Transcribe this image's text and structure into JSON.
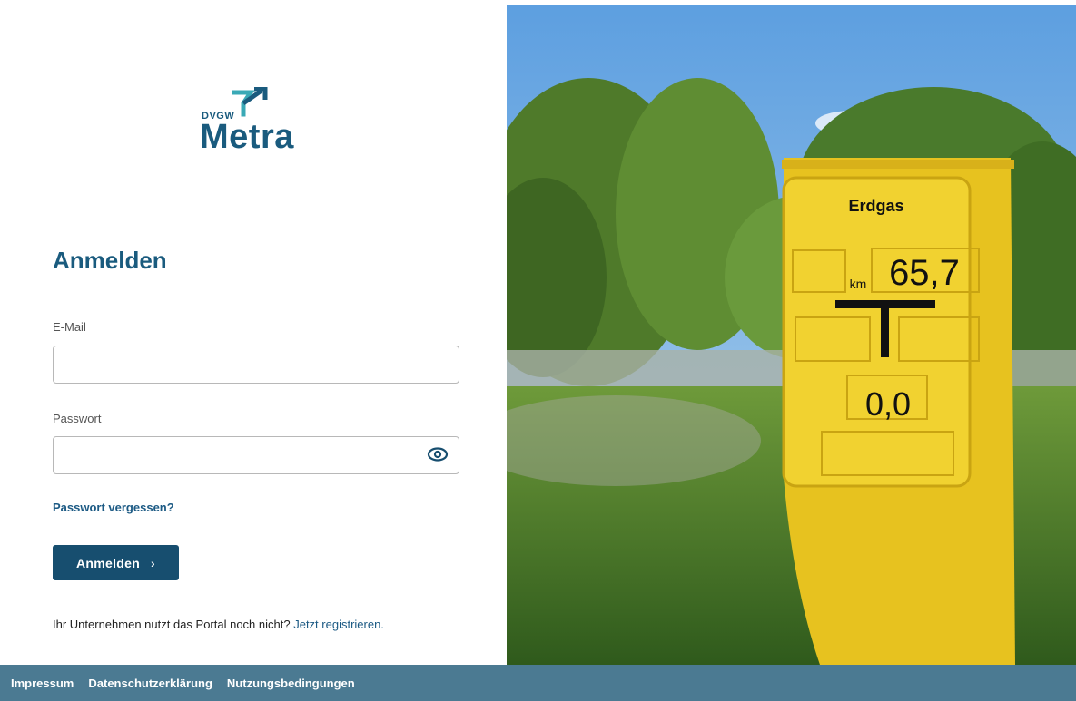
{
  "colors": {
    "brand_blue": "#1a5b7e",
    "brand_teal": "#3aa9b6",
    "button_bg": "#174e6f",
    "footer_bg": "#4b7a92",
    "link": "#1c5a84"
  },
  "logo": {
    "prefix": "DVGW",
    "name": "Metra"
  },
  "login": {
    "title": "Anmelden",
    "email_label": "E-Mail",
    "email_value": "",
    "password_label": "Passwort",
    "password_value": "",
    "forgot_link": "Passwort vergessen?",
    "submit_label": "Anmelden",
    "submit_icon": "chevron-right-icon",
    "password_toggle_icon": "eye-icon",
    "register_text": "Ihr Unternehmen nutzt das Portal noch nicht?",
    "register_link": "Jetzt registrieren."
  },
  "photo": {
    "marker_title": "Erdgas",
    "km_label": "km",
    "km_value": "65,7",
    "offset_value": "0,0"
  },
  "footer": {
    "links": [
      "Impressum",
      "Datenschutzerklärung",
      "Nutzungsbedingungen"
    ]
  }
}
